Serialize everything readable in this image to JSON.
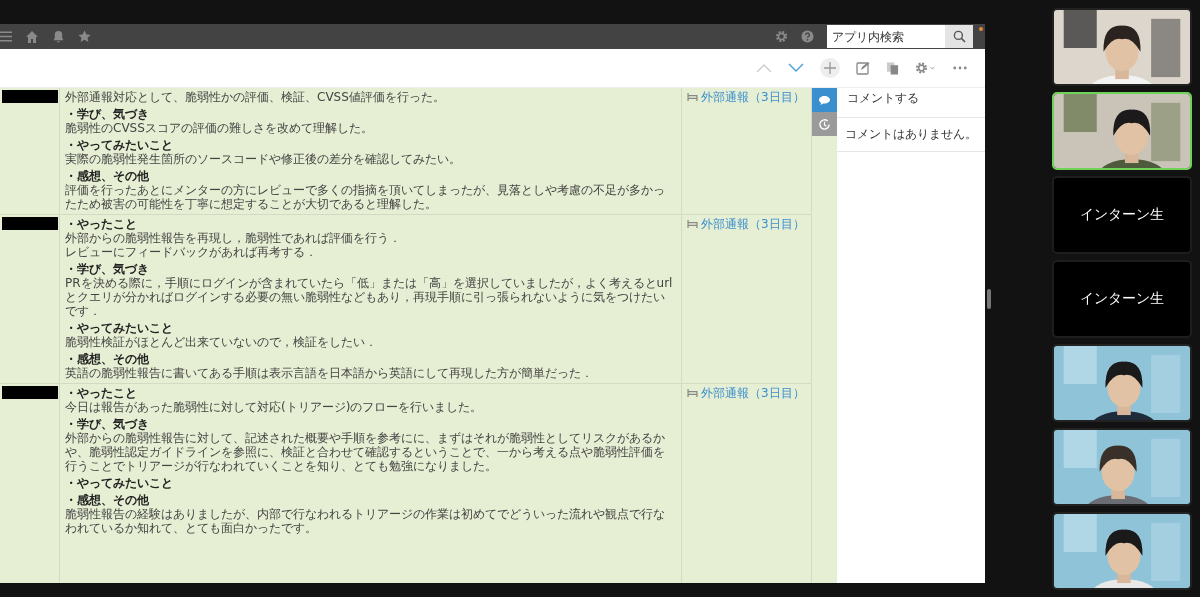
{
  "top_bar": {
    "search": {
      "placeholder": "アプリ内検索"
    }
  },
  "record_nav": [
    {
      "kind": "up",
      "disabled": true
    },
    {
      "kind": "down",
      "disabled": false
    }
  ],
  "records": [
    {
      "link": "外部通報（3日目）",
      "sections": [
        {
          "body": [
            "外部通報対応として、脆弱性かの評価、検証、CVSS値評価を行った。"
          ]
        },
        {
          "heading": "・学び、気づき",
          "body": [
            "脆弱性のCVSSスコアの評価の難しさを改めて理解した。"
          ]
        },
        {
          "heading": "・やってみたいこと",
          "body": [
            "実際の脆弱性発生箇所のソースコードや修正後の差分を確認してみたい。"
          ]
        },
        {
          "heading": "・感想、その他",
          "body": [
            "評価を行ったあとにメンターの方にレビューで多くの指摘を頂いてしまったが、見落としや考慮の不足が多かったため被害の可能性を丁寧に想定することが大切であると理解した。"
          ]
        }
      ]
    },
    {
      "link": "外部通報（3日目）",
      "sections": [
        {
          "heading": "・やったこと",
          "body": [
            "外部からの脆弱性報告を再現し，脆弱性であれば評価を行う．",
            "レビューにフィードバックがあれば再考する．"
          ]
        },
        {
          "heading": "・学び、気づき",
          "body": [
            "PRを決める際に，手順にログインが含まれていたら「低」または「高」を選択していましたが，よく考えるとurlとクエリが分かればログインする必要の無い脆弱性などもあり，再現手順に引っ張られないように気をつけたいです．"
          ]
        },
        {
          "heading": "・やってみたいこと",
          "body": [
            "脆弱性検証がほとんど出来ていないので，検証をしたい．"
          ]
        },
        {
          "heading": "・感想、その他",
          "body": [
            "英語の脆弱性報告に書いてある手順は表示言語を日本語から英語にして再現した方が簡単だった．"
          ]
        }
      ]
    },
    {
      "link": "外部通報（3日目）",
      "sections": [
        {
          "heading": "・やったこと",
          "body": [
            "今日は報告があった脆弱性に対して対応(トリアージ)のフローを行いました。"
          ]
        },
        {
          "heading": "・学び、気づき",
          "body": [
            "外部からの脆弱性報告に対して、記述された概要や手順を参考にに、まずはそれが脆弱性としてリスクがあるかや、脆弱性認定ガイドラインを参照に、検証と合わせて確認するということで、一から考える点や脆弱性評価を行うことでトリアージが行なわれていくことを知り、とても勉強になりました。"
          ]
        },
        {
          "heading": "・やってみたいこと"
        },
        {
          "heading": "・感想、その他",
          "body": [
            "脆弱性報告の経験はありましたが、内部で行なわれるトリアージの作業は初めてでどういった流れや観点で行なわれているか知れて、とても面白かったです。"
          ]
        }
      ]
    }
  ],
  "side_tabs": [
    {
      "kind": "comments",
      "selected": true
    },
    {
      "kind": "history",
      "selected": false
    }
  ],
  "comment_panel": {
    "placeholder": "コメントする",
    "empty_message": "コメントはありません。"
  },
  "participants": [
    {
      "kind": "video",
      "speaking": false
    },
    {
      "kind": "video",
      "speaking": true
    },
    {
      "kind": "name",
      "name": "インターン生",
      "speaking": false
    },
    {
      "kind": "name",
      "name": "インターン生",
      "speaking": false
    },
    {
      "kind": "video",
      "speaking": false
    },
    {
      "kind": "video",
      "speaking": false
    },
    {
      "kind": "video",
      "speaking": false
    }
  ]
}
